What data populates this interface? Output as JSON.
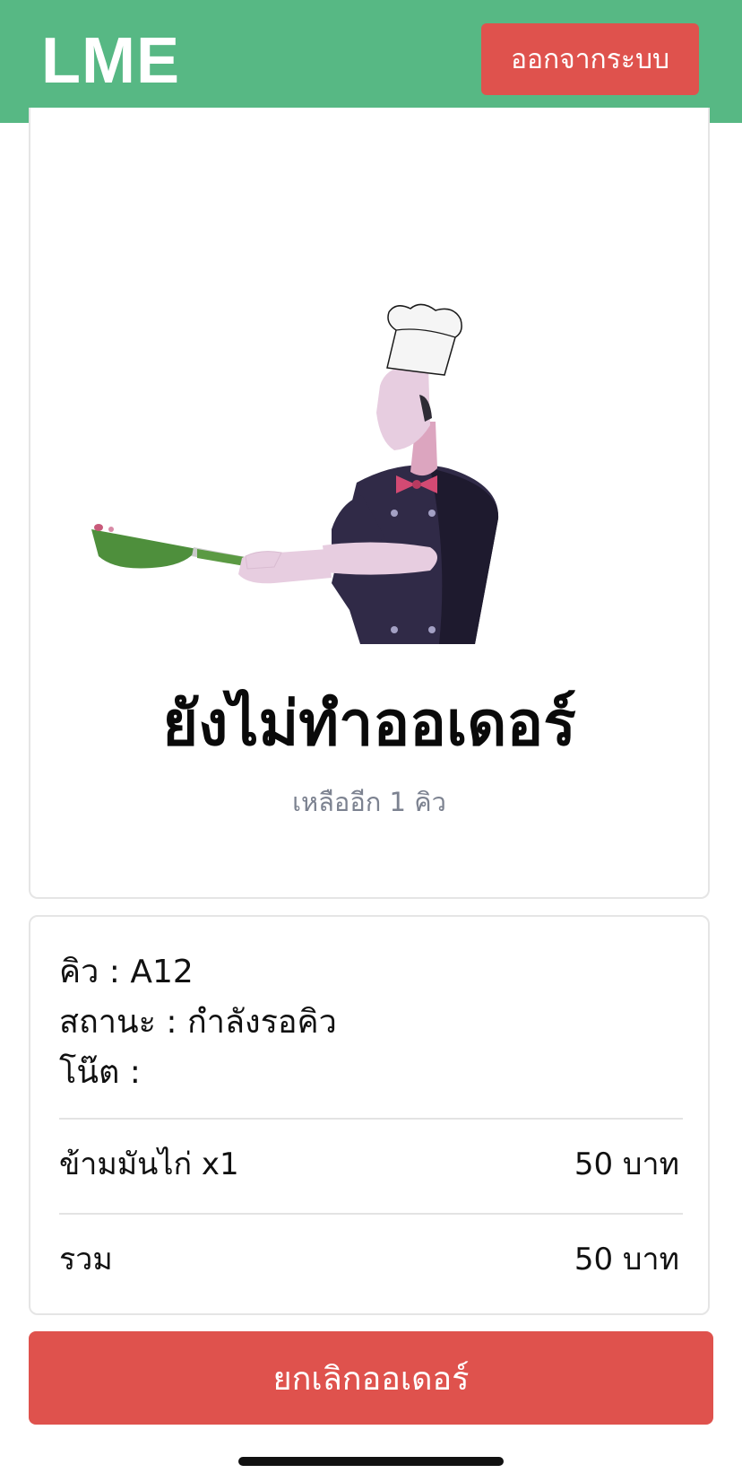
{
  "header": {
    "brand": "LME",
    "logout_label": "ออกจากระบบ"
  },
  "status": {
    "title": "ยังไม่ทำออเดอร์",
    "queue_remaining": "เหลืออีก 1 คิว"
  },
  "order": {
    "queue_line": "คิว : A12",
    "status_line": "สถานะ : กำลังรอคิว",
    "note_line": "โน๊ต :",
    "items": [
      {
        "name": "ข้ามมันไก่ x1",
        "price": "50 บาท"
      }
    ],
    "total_label": "รวม",
    "total_value": "50 บาท"
  },
  "actions": {
    "cancel_label": "ยกเลิกออเดอร์"
  },
  "colors": {
    "header_green": "#57b884",
    "danger_red": "#df524d",
    "muted_gray": "#7c8290"
  }
}
